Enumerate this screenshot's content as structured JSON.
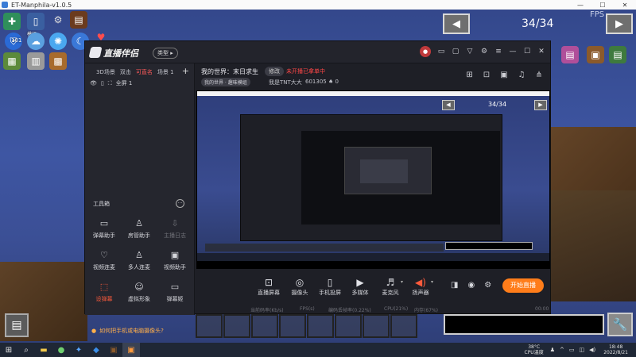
{
  "window": {
    "title": "ET-Manphila-v1.0.5",
    "controls": [
      "—",
      "☐",
      "✕"
    ]
  },
  "game": {
    "hud_labels": {
      "coins": "101",
      "status": "模组"
    },
    "page_counter": "34/34",
    "prev_arrow": "◀",
    "next_arrow": "▶",
    "fps_text": "FPS"
  },
  "companion": {
    "logo": "直播伴侣",
    "logo_badge": "类型 ▸",
    "scene_tabs": [
      "3D场景",
      "双击",
      "可直名",
      "场景 1"
    ],
    "active_scene_tab": 2,
    "add_scene": "+",
    "scene_item": "全屏 1",
    "toolbox_title": "工具箱",
    "toolbox_more": "···",
    "tools": [
      {
        "icon": "▭",
        "label": "弹幕助手",
        "style": ""
      },
      {
        "icon": "♙",
        "label": "房管助手",
        "style": ""
      },
      {
        "icon": "⇩",
        "label": "主播日志",
        "style": "dim"
      },
      {
        "icon": "♡",
        "label": "视频连麦",
        "style": ""
      },
      {
        "icon": "♙",
        "label": "多人连麦",
        "style": ""
      },
      {
        "icon": "▣",
        "label": "视频助手",
        "style": ""
      },
      {
        "icon": "⬚",
        "label": "设弹幕",
        "style": "red"
      },
      {
        "icon": "☺",
        "label": "虚拟形象",
        "style": ""
      },
      {
        "icon": "▭",
        "label": "弹幕姬",
        "style": ""
      }
    ],
    "tip": "如何把手机或电脑摄像头?",
    "room": {
      "title": "我的世界：末日求生",
      "edit": "修改",
      "status": "未开播已拿单中",
      "category": "我的世界 · 趣味模组",
      "user": "我是TNT大大",
      "id": "601305",
      "likes": "0"
    },
    "preview": {
      "counter": "34/34"
    },
    "controls": [
      {
        "icon": "⊡",
        "label": "直播屏幕",
        "style": ""
      },
      {
        "icon": "◎",
        "label": "摄像头",
        "style": ""
      },
      {
        "icon": "▯",
        "label": "手机投屏",
        "style": ""
      },
      {
        "icon": "▶",
        "label": "多媒体",
        "style": ""
      },
      {
        "icon": "♬",
        "label": "麦克风",
        "style": ""
      },
      {
        "icon": "◀)",
        "label": "扬声器",
        "style": "red"
      }
    ],
    "start_label": "开始直播",
    "stats": [
      "当前码率(Kb/s)",
      "FPS(s)",
      "编码丢帧率(0.22%)",
      "CPU(21%)",
      "内存(67%)",
      "00:00"
    ]
  },
  "taskbar": {
    "temp_value": "38°C",
    "temp_label": "CPU温度",
    "time": "18:48",
    "date": "2022/8/21"
  }
}
